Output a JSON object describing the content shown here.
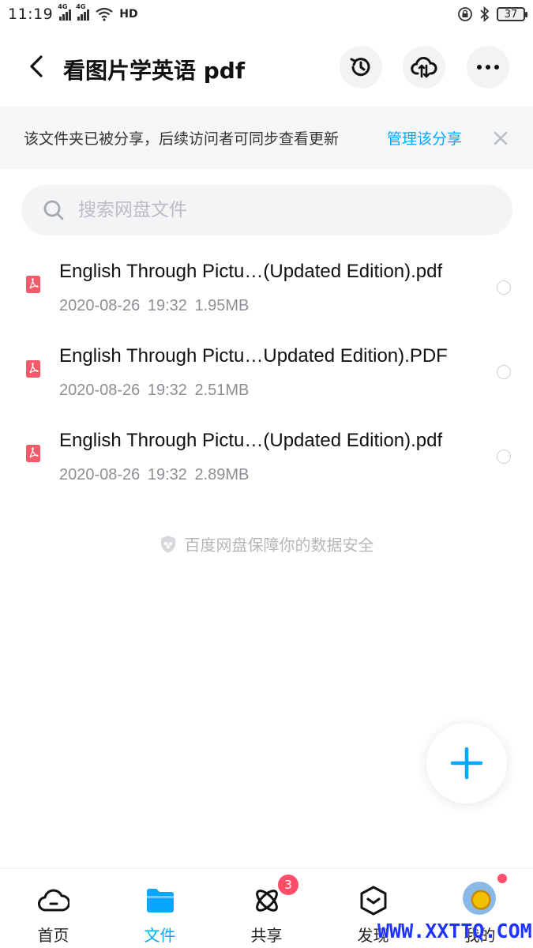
{
  "status_bar": {
    "time": "11:19",
    "signal_1_label": "4G",
    "signal_2_label": "4G",
    "hd_label": "HD",
    "battery": "37"
  },
  "header": {
    "title": "看图片学英语 pdf"
  },
  "banner": {
    "text": "该文件夹已被分享，后续访问者可同步查看更新",
    "link": "管理该分享"
  },
  "search": {
    "placeholder": "搜索网盘文件"
  },
  "files": [
    {
      "name": "English Through Pictu…(Updated Edition).pdf",
      "meta": "2020-08-26  19:32  1.95MB"
    },
    {
      "name": "English Through Pictu…Updated Edition).PDF",
      "meta": "2020-08-26  19:32  2.51MB"
    },
    {
      "name": "English Through Pictu…(Updated Edition).pdf",
      "meta": "2020-08-26  19:32  2.89MB"
    }
  ],
  "safety_note": "百度网盘保障你的数据安全",
  "bottom_nav": {
    "items": [
      {
        "label": "首页",
        "icon": "cloud-icon"
      },
      {
        "label": "文件",
        "icon": "folder-icon"
      },
      {
        "label": "共享",
        "icon": "share-orbit-icon"
      },
      {
        "label": "发现",
        "icon": "discover-icon"
      },
      {
        "label": "我的",
        "icon": "avatar"
      }
    ],
    "share_badge": "3"
  },
  "watermark": "WWW.XXTTQ.COM",
  "colors": {
    "accent": "#06a7ff",
    "badge": "#ff4d6a",
    "pdf": "#f55a6a"
  }
}
